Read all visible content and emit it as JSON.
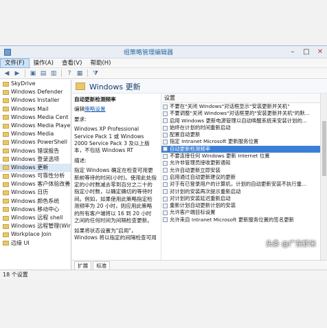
{
  "window": {
    "title": "组策略管理编辑器"
  },
  "menu": [
    "文件(F)",
    "操作(A)",
    "查看(V)",
    "帮助(H)"
  ],
  "tree": [
    "SkyDrive",
    "Windows Defender",
    "Windows Installer",
    "Windows Mail",
    "Windows Media Cent",
    "Windows Media Playe",
    "Windows Media",
    "Windows PowerShell",
    "Windows 错误报告",
    "Windows 登录选项",
    "Windows 更新",
    "Windows 可靠性分析",
    "Windows 客户体验改善",
    "Windows 日历",
    "Windows 颜色系统",
    "Windows 移动中心",
    "Windows 远程 shell",
    "Windows 远程管理(Wir",
    "Workplace Join",
    "边缘 UI"
  ],
  "section": {
    "title": "Windows 更新"
  },
  "description": {
    "heading": "自动更新检测频率",
    "edit_prefix": "编辑",
    "edit_link": "策略设置",
    "requirements_label": "要求:",
    "requirements_text": "Windows XP Professional Service Pack 1 或 Windows 2000 Service Pack 3 及以上版本，不包括 Windows RT",
    "desc_label": "描述:",
    "desc_text": "指定 Windows 确定在检查可用更新前等待的时间(小时)。使用此处指定的小时数减去零到百分之二十的指定小时数，以确定确切的等待时间。例如，如果使用此策略指定检测频率为 20 小时，则应用此策略的所有客户端将以 16 到 20 小时之间的任何时间为间隔检查更新。",
    "desc_text2": "如果将状态设置为\"启用\"，Windows 将以指定的间隔检查可用"
  },
  "settings": {
    "column": "设置",
    "rows": [
      "不要在\"关闭 Windows\"对话框显示\"安装更新并关机\"",
      "不要调整\"关闭 Windows\"对话框里的\"安装更新并关机\"的默...",
      "启用 Windows 更新电源管理以自动唤醒系统来安装计划的...",
      "始终在计划的时间重新启动",
      "配置自动更新",
      "指定 Intranet Microsoft 更新服务位置",
      "自动更新检测频率",
      "不要连接任何 Windows 更新 Internet 位置",
      "允许非管理员接收更新通知",
      "允许自动更新立即安装",
      "启用通过自动更新建议的更新",
      "对于有已登录用户的计算机，计划的自动更新安装不执行重...",
      "对计划的安装再次提示重新启动",
      "对计划的安装延迟重新启动",
      "重新计划自动更新计划的安装",
      "允许客户端目标设置",
      "允许来自 Intranet Microsoft 更新服务位置的签名更新"
    ],
    "selected_index": 6
  },
  "tabs": [
    "扩展",
    "标准"
  ],
  "status": {
    "text": "18 个设置"
  },
  "watermark": "头条 @广东虾米"
}
